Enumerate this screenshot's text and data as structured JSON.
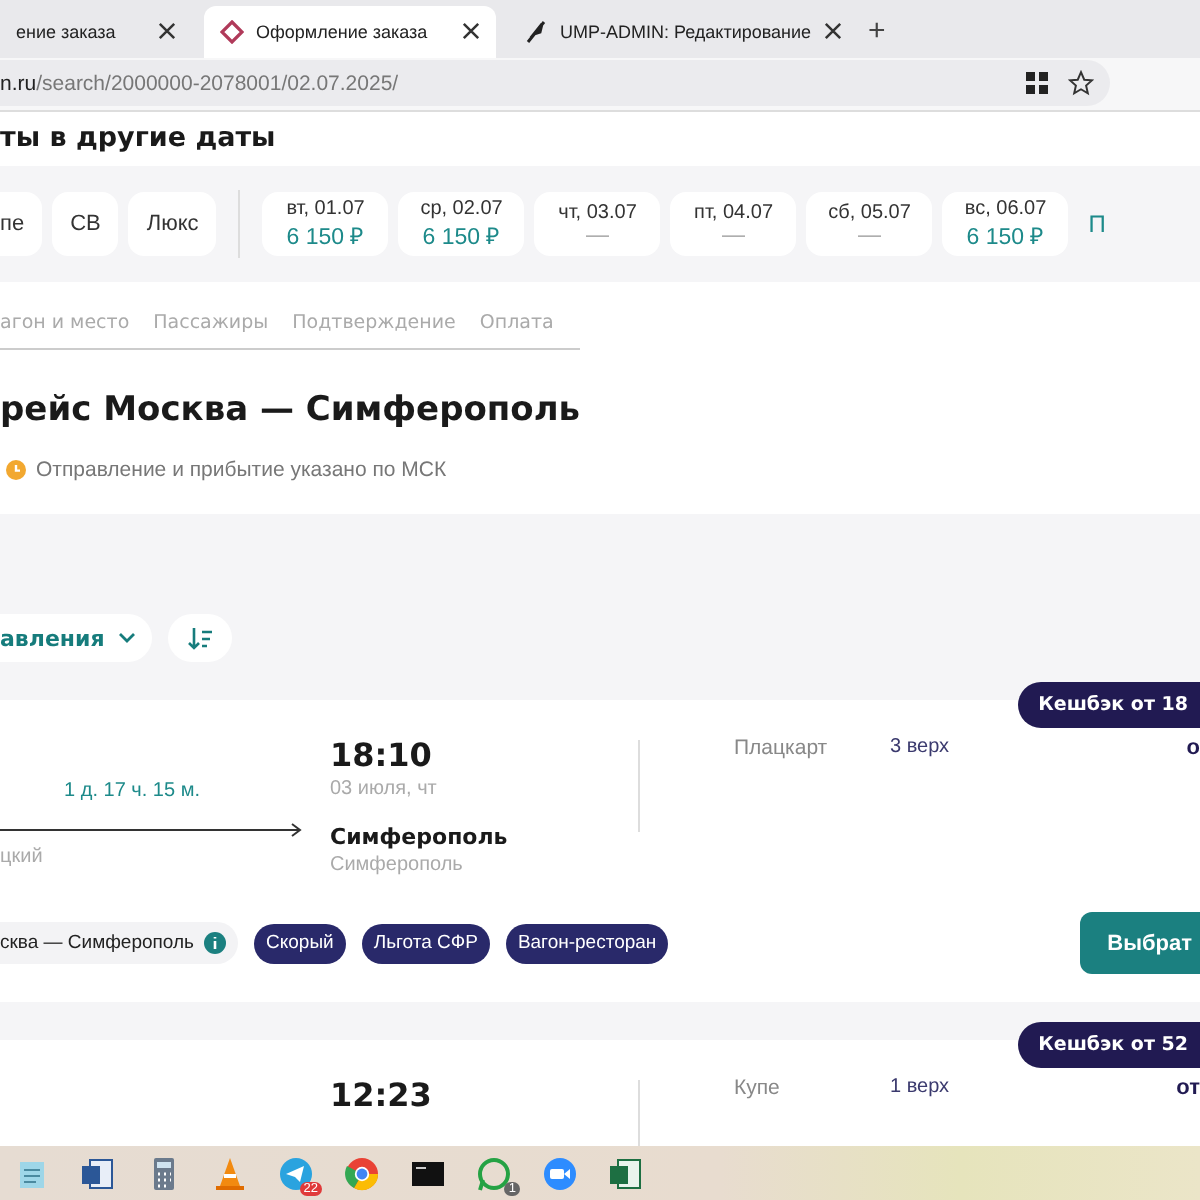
{
  "browser": {
    "tabs": [
      {
        "title": "ение заказа",
        "selected": false
      },
      {
        "title": "Оформление заказа",
        "selected": true,
        "kind": "diamond"
      },
      {
        "title": "UMP-ADMIN: Редактирование",
        "selected": false,
        "kind": "feather"
      }
    ],
    "new_tab": "+",
    "url": {
      "host": "n.ru",
      "path": "/search/2000000-2078001/02.07.2025/"
    }
  },
  "section_title": "ты в другие даты",
  "car_types": [
    "пе",
    "СВ",
    "Люкс"
  ],
  "dates": [
    {
      "day": "вт, 01.07",
      "price": "6 150 ₽"
    },
    {
      "day": "ср, 02.07",
      "price": "6 150 ₽"
    },
    {
      "day": "чт, 03.07",
      "price": "—"
    },
    {
      "day": "пт, 04.07",
      "price": "—"
    },
    {
      "day": "сб, 05.07",
      "price": "—"
    },
    {
      "day": "вс, 06.07",
      "price": "6 150 ₽"
    }
  ],
  "more_link": "П",
  "steps": [
    "агон и место",
    "Пассажиры",
    "Подтверждение",
    "Оплата"
  ],
  "title": "рейс Москва — Симферополь",
  "notice": "Отправление и прибытие указано по МСК",
  "filter": "авления",
  "trains": [
    {
      "cashback": "Кешбэк от 18",
      "duration": "1 д. 17 ч. 15 м.",
      "from_station": "цкий",
      "arrival_time": "18:10",
      "arrival_date": "03 июля, чт",
      "arrival_city": "Симферополь",
      "arrival_station": "Симферополь",
      "class": "Плацкарт",
      "seat": "3 верх",
      "price": "о",
      "route": "сква — Симферополь",
      "tags": [
        "Скорый",
        "Льгота СФР",
        "Вагон-ресторан"
      ],
      "button": "Выбрат"
    },
    {
      "cashback": "Кешбэк от 52",
      "arrival_time": "12:23",
      "class": "Купе",
      "seat": "1 верх",
      "price": "от"
    }
  ],
  "taskbar": [
    {
      "kind": "notepad"
    },
    {
      "kind": "doc-blue"
    },
    {
      "kind": "calculator"
    },
    {
      "kind": "cone"
    },
    {
      "kind": "plane",
      "badge": "22"
    },
    {
      "kind": "browser"
    },
    {
      "kind": "terminal"
    },
    {
      "kind": "chat",
      "badge": "1"
    },
    {
      "kind": "camera"
    },
    {
      "kind": "sheet"
    }
  ]
}
